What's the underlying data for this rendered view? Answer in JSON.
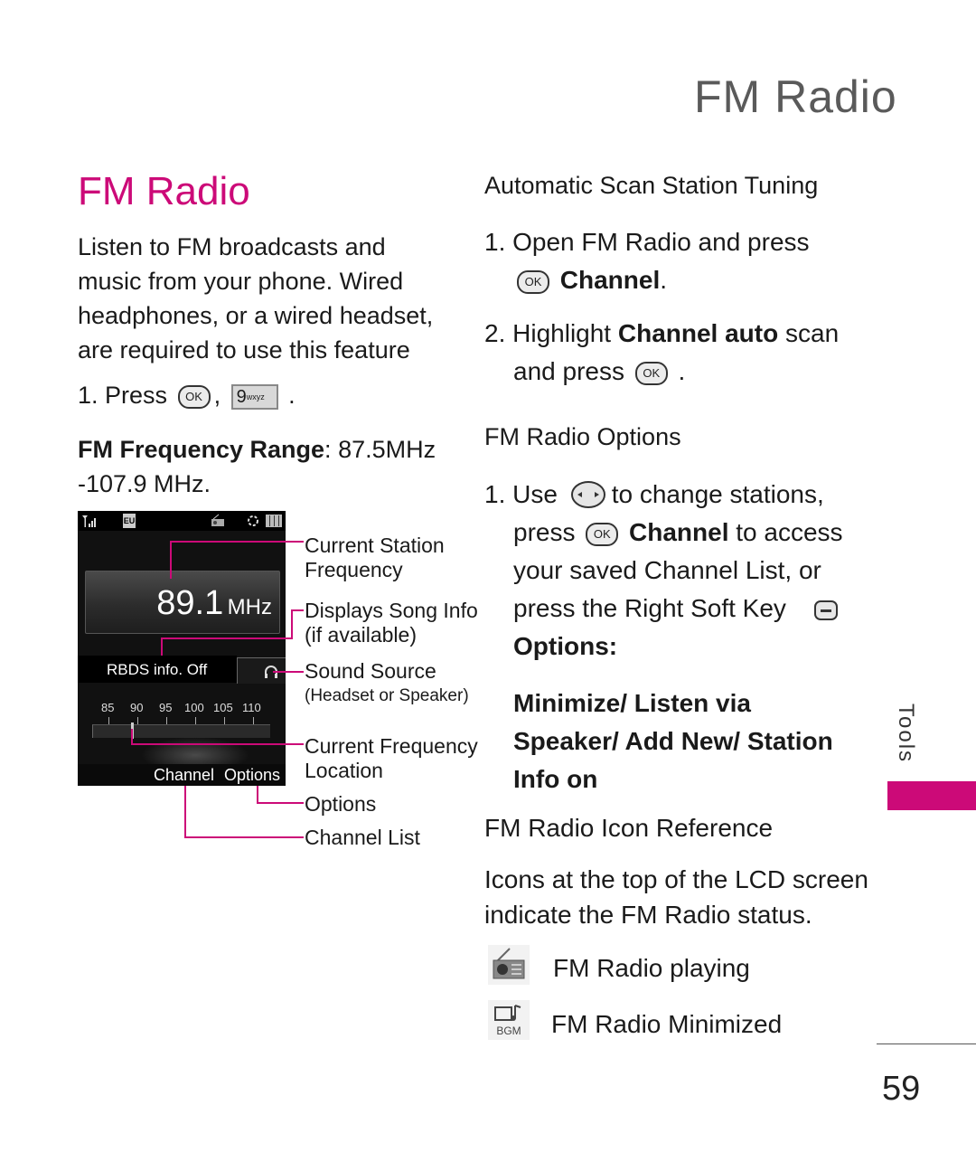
{
  "running_head": "FM Radio",
  "title": "FM Radio",
  "intro_lines": [
    "Listen to FM broadcasts and",
    "music from your phone. Wired",
    "headphones, or a wired headset,",
    "are required to use this feature"
  ],
  "step1": {
    "prefix": "1. Press",
    "key_ok": "OK",
    "sep": ",",
    "key9_digit": "9",
    "key9_letters": "wxyz",
    "suffix": "."
  },
  "freq_range": {
    "label": "FM Frequency Range",
    "colon": ":",
    "value_line1": " 87.5MHz",
    "value_line2": "-107.9 MHz."
  },
  "screen": {
    "status_icons": [
      "signal-icon",
      "eu-icon",
      "radio-icon",
      "bluetooth-icon",
      "battery-icon"
    ],
    "eu_label": "EU",
    "frequency": "89.1",
    "unit": "MHz",
    "rbds": "RBDS info. Off",
    "scale": [
      "85",
      "90",
      "95",
      "100",
      "105",
      "110"
    ],
    "current_position_mhz": 89.1,
    "softkeys": {
      "left": "Channel",
      "right": "Options"
    }
  },
  "callouts": {
    "station_freq": [
      "Current Station",
      "Frequency"
    ],
    "song_info": [
      "Displays Song Info",
      "(if available)"
    ],
    "sound_source": [
      "Sound Source",
      "(Headset or Speaker)"
    ],
    "freq_location": [
      "Current Frequency",
      "Location"
    ],
    "options": "Options",
    "channel_list": "Channel List"
  },
  "auto_scan": {
    "heading": "Automatic Scan Station Tuning",
    "s1_line1": "1. Open FM Radio and press",
    "s1_key": "OK",
    "s1_bold": "Channel",
    "s1_end": ".",
    "s2_prefix": "2. Highlight ",
    "s2_bold": "Channel auto",
    "s2_suffix": " scan",
    "s2_line2": "and press",
    "s2_key": "OK",
    "s2_end": "."
  },
  "options": {
    "heading": "FM Radio Options",
    "l1_prefix": "1. Use",
    "l1_suffix": "to change stations,",
    "l2_prefix": "press",
    "l2_key": "OK",
    "l2_bold": "Channel",
    "l2_suffix": " to access",
    "l3": "your saved Channel List, or",
    "l4": "press the Right Soft Key",
    "l5": "Options:",
    "list": [
      "Minimize/ Listen via",
      "Speaker/ Add New/ Station",
      "Info on"
    ]
  },
  "icon_ref": {
    "heading": "FM Radio Icon Reference",
    "desc": [
      "Icons at the top of the LCD screen",
      "indicate the FM Radio status."
    ],
    "items": [
      {
        "icon": "radio-playing-icon",
        "label": "FM Radio playing"
      },
      {
        "icon": "radio-minimized-icon",
        "label": "FM Radio Minimized",
        "icon_text": "BGM"
      }
    ]
  },
  "side_tab": "Tools",
  "page_number": "59",
  "accent_color": "#cc0a78"
}
